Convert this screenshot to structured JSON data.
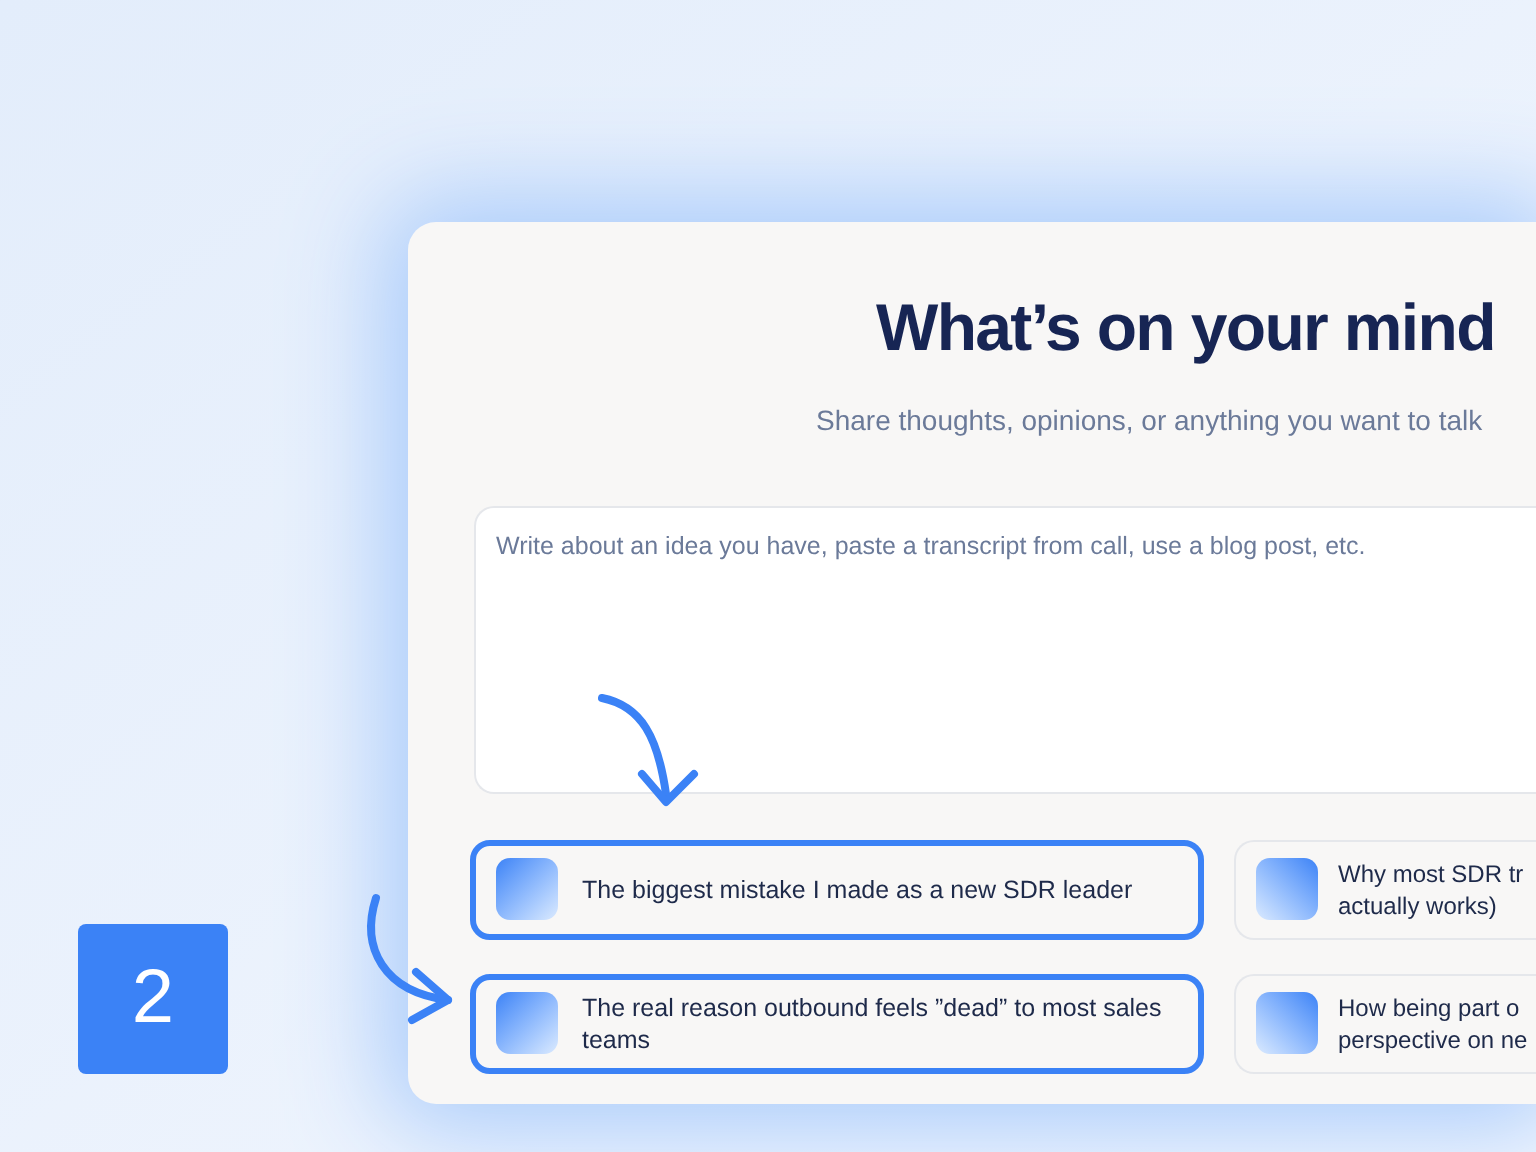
{
  "step_badge": "2",
  "heading": "What’s on your mind",
  "subtitle": "Share thoughts, opinions, or anything you want to talk",
  "input": {
    "placeholder": "Write about an idea you have, paste a transcript from call, use a blog post, etc."
  },
  "suggestions": [
    {
      "text": "The biggest mistake I made as a new SDR leader",
      "selected": true
    },
    {
      "text": "The real reason outbound feels ”dead” to most sales teams",
      "selected": true
    },
    {
      "text": "Why most SDR tr\nactually works)",
      "selected": false
    },
    {
      "text": "How being part o\nperspective on ne",
      "selected": false
    }
  ]
}
